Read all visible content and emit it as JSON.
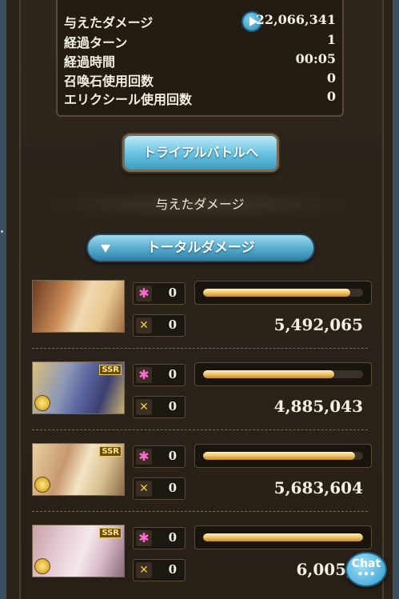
{
  "stats": {
    "rows": [
      {
        "label": "与えたダメージ",
        "value": "22,066,341"
      },
      {
        "label": "経過ターン",
        "value": "1"
      },
      {
        "label": "経過時間",
        "value": "00:05"
      },
      {
        "label": "召喚石使用回数",
        "value": "0"
      },
      {
        "label": "エリクシール使用回数",
        "value": "0"
      }
    ]
  },
  "actions": {
    "trial_label": "トライアルバトルへ",
    "total_damage_label": "トータルダメージ"
  },
  "section": {
    "title": "与えたダメージ"
  },
  "characters": [
    {
      "star": "0",
      "ca": "0",
      "damage": "5,492,065",
      "bar": 0.92,
      "ssr": ""
    },
    {
      "star": "0",
      "ca": "0",
      "damage": "4,885,043",
      "bar": 0.82,
      "ssr": "SSR"
    },
    {
      "star": "0",
      "ca": "0",
      "damage": "5,683,604",
      "bar": 0.95,
      "ssr": "SSR"
    },
    {
      "star": "0",
      "ca": "0",
      "damage": "6,005,6",
      "bar": 1.0,
      "ssr": "SSR"
    }
  ],
  "chat": {
    "label": "Chat",
    "dots": "•••"
  },
  "icons": [
    "play-icon",
    "star-icon",
    "charge-attack-icon",
    "coin-icon",
    "chevron-down-icon"
  ],
  "colors": {
    "accent_blue": "#6cc4e2",
    "bar_gold": "#f0c368",
    "star_pink": "#ff6ad5"
  }
}
